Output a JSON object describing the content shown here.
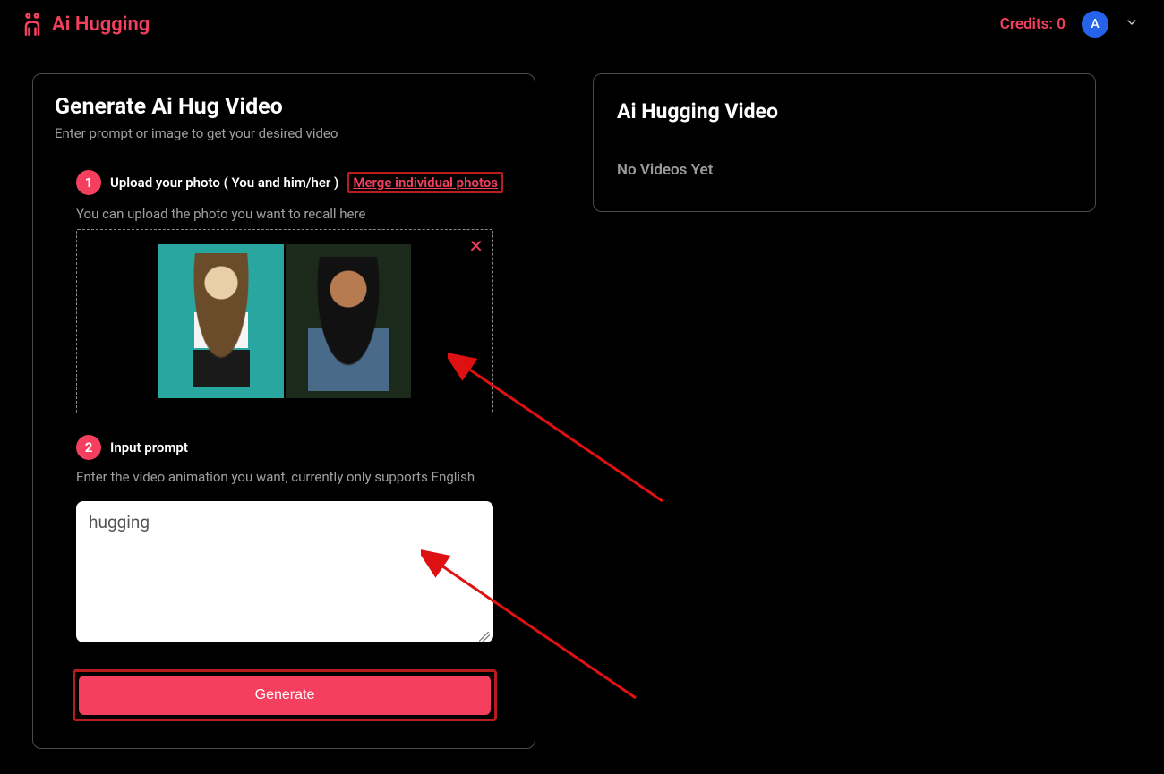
{
  "header": {
    "brand": "Ai Hugging",
    "credits_label": "Credits: 0",
    "avatar_letter": "A"
  },
  "left": {
    "title": "Generate Ai Hug Video",
    "subtitle": "Enter prompt or image to get your desired video",
    "step1": {
      "num": "1",
      "label": "Upload your photo ( You and him/her )",
      "merge_link": "Merge individual photos",
      "hint": "You can upload the photo you want to recall here"
    },
    "step2": {
      "num": "2",
      "label": "Input prompt",
      "hint": "Enter the video animation you want, currently only supports English",
      "value": "hugging"
    },
    "generate_label": "Generate"
  },
  "right": {
    "title": "Ai Hugging Video",
    "empty": "No Videos Yet"
  }
}
